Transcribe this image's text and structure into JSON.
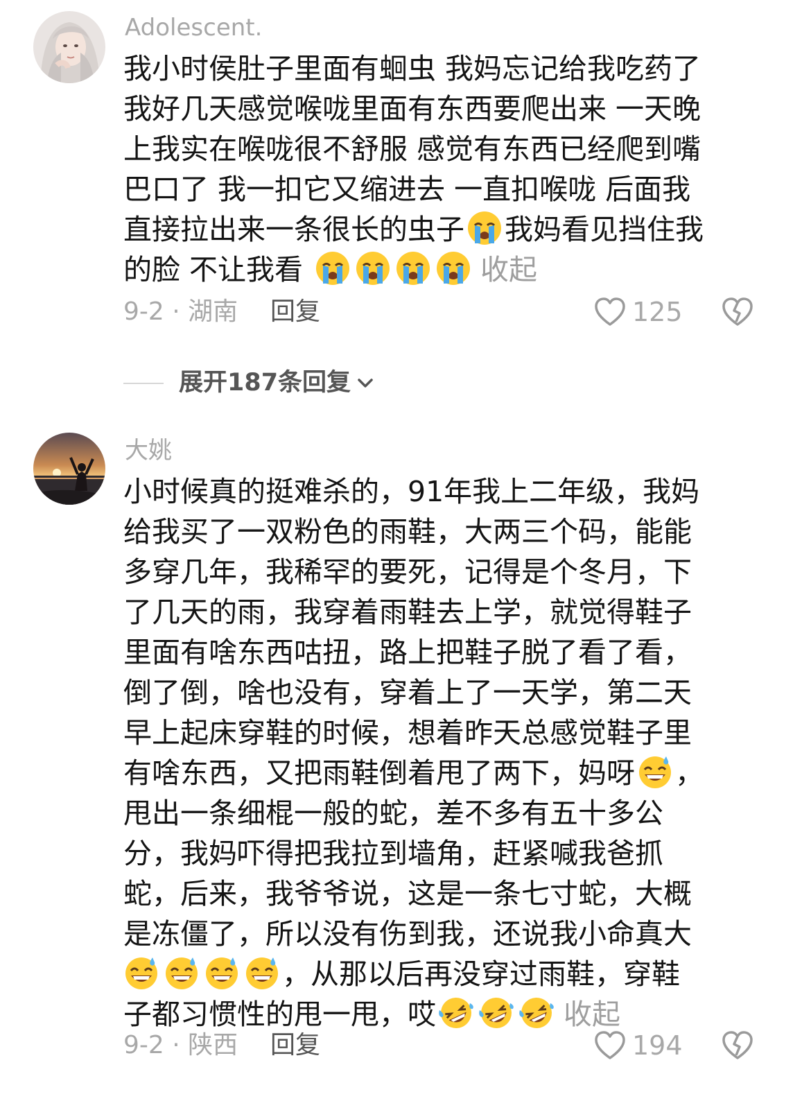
{
  "comments": [
    {
      "username": "Adolescent.",
      "avatar": "avatar-photo",
      "lines": [
        "我小时侯肚子里面有蛔虫 我妈忘记给我吃药了",
        "我好几天感觉喉咙里面有东西要爬出来 一天晚",
        "上我实在喉咙很不舒服 感觉有东西已经爬到嘴",
        "巴口了 我一扣它又缩进去 一直扣喉咙 后面我",
        "直接拉出来一条很长的虫子",
        "我妈看见挡住我",
        "的脸 不让我看"
      ],
      "collapse_label": "收起",
      "date_location": "9-2 · 湖南",
      "reply_label": "回复",
      "like_count": "125",
      "emoji_name": "loudly-crying-face"
    },
    {
      "username": "大姚",
      "avatar": "avatar-photo",
      "lines": [
        "小时候真的挺难杀的，91年我上二年级，我妈",
        "给我买了一双粉色的雨鞋，大两三个码，能能",
        "多穿几年，我稀罕的要死，记得是个冬月，下",
        "了几天的雨，我穿着雨鞋去上学，就觉得鞋子",
        "里面有啥东西咕扭，路上把鞋子脱了看了看，",
        "倒了倒，啥也没有，穿着上了一天学，第二天",
        "早上起床穿鞋的时候，想着昨天总感觉鞋子里",
        "有啥东西，又把雨鞋倒着甩了两下，妈呀",
        "，",
        "甩出一条细棍一般的蛇，差不多有五十多公",
        "分，我妈吓得把我拉到墙角，赶紧喊我爸抓",
        "蛇，后来，我爷爷说，这是一条七寸蛇，大概",
        "是冻僵了，所以没有伤到我，还说我小命真大",
        "，从那以后再没穿过雨鞋，穿鞋",
        "子都习惯性的甩一甩，哎"
      ],
      "collapse_label": "收起",
      "date_location": "9-2 · 陕西",
      "reply_label": "回复",
      "like_count": "194",
      "emoji_names": [
        "grinning-face-with-sweat",
        "rolling-on-the-floor-laughing"
      ]
    }
  ],
  "expand_replies_label": "展开187条回复",
  "colors": {
    "username": "#a8a8a8",
    "body": "#141414",
    "meta": "#a8a8a8",
    "reply": "#555555",
    "divider": "#d6d6d6"
  },
  "icons": [
    "heart-outline-icon",
    "broken-heart-icon",
    "chevron-down-icon"
  ]
}
